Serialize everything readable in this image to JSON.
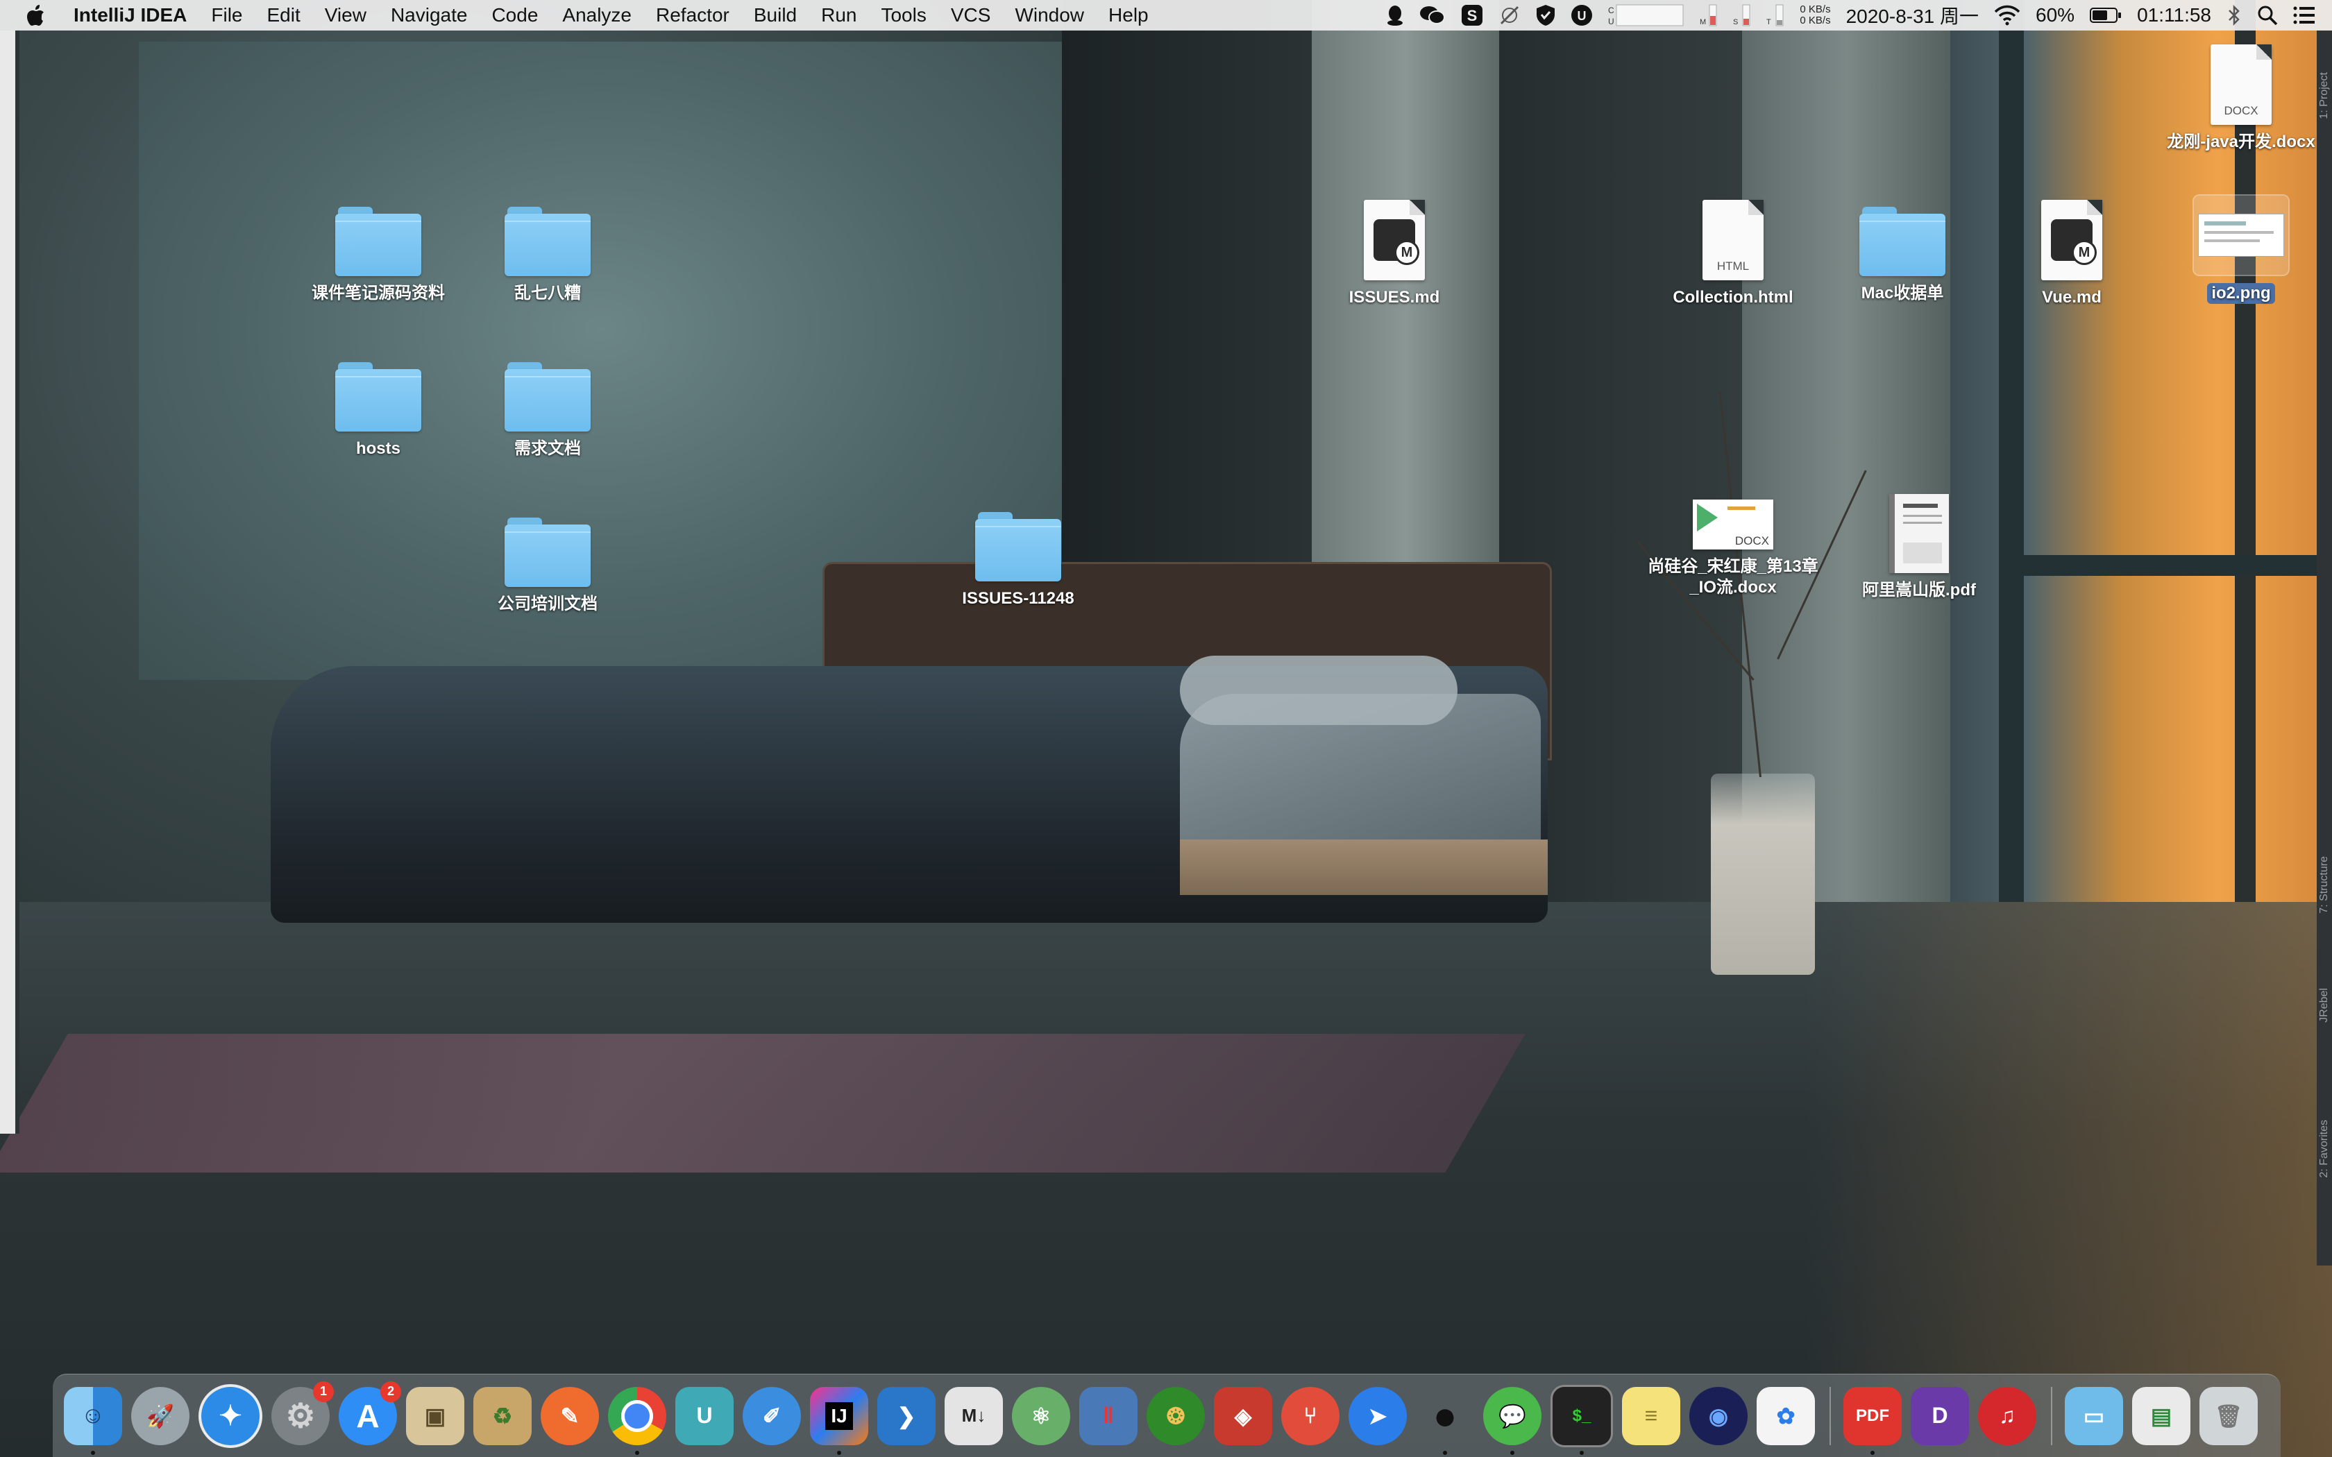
{
  "menubar": {
    "app_name": "IntelliJ IDEA",
    "menus": [
      "File",
      "Edit",
      "View",
      "Navigate",
      "Code",
      "Analyze",
      "Refactor",
      "Build",
      "Run",
      "Tools",
      "VCS",
      "Window",
      "Help"
    ],
    "net_up": "0 KB/s",
    "net_down": "0 KB/s",
    "date": "2020-8-31 周一",
    "battery": "60%",
    "time": "01:11:58"
  },
  "desktop": {
    "icons": [
      {
        "label": "课件笔记源码资料",
        "kind": "folder"
      },
      {
        "label": "乱七八糟",
        "kind": "folder"
      },
      {
        "label": "hosts",
        "kind": "folder"
      },
      {
        "label": "需求文档",
        "kind": "folder"
      },
      {
        "label": "公司培训文档",
        "kind": "folder"
      },
      {
        "label": "ISSUES-11248",
        "kind": "folder"
      },
      {
        "label": "ISSUES.md",
        "kind": "markdown"
      },
      {
        "label": "Collection.html",
        "kind": "html",
        "tag": "HTML"
      },
      {
        "label": "Mac收据单",
        "kind": "folder"
      },
      {
        "label": "Vue.md",
        "kind": "markdown"
      },
      {
        "label": "io2.png",
        "kind": "image"
      },
      {
        "label": "龙刚-java开发.docx",
        "kind": "docx",
        "tag": "DOCX"
      },
      {
        "label": "尚硅谷_宋红康_第13章_IO流.docx",
        "kind": "docx",
        "tag": "DOCX"
      },
      {
        "label": "阿里嵩山版.pdf",
        "kind": "pdf"
      }
    ]
  },
  "sidebar_right": {
    "labels": [
      "1: Project",
      "7: Structure",
      "JRebel",
      "2: Favorites"
    ]
  },
  "dock": {
    "apps": [
      {
        "name": "Finder",
        "badge": "",
        "running": true
      },
      {
        "name": "Launchpad",
        "badge": "",
        "running": false
      },
      {
        "name": "Safari",
        "badge": "",
        "running": false
      },
      {
        "name": "System Preferences",
        "badge": "1",
        "running": false
      },
      {
        "name": "App Store",
        "badge": "2",
        "running": false
      },
      {
        "name": "Preview",
        "badge": "",
        "running": false
      },
      {
        "name": "Archive Utility",
        "badge": "",
        "running": false
      },
      {
        "name": "Postman",
        "badge": "",
        "running": false
      },
      {
        "name": "Chrome",
        "badge": "",
        "running": true
      },
      {
        "name": "Typora",
        "badge": "",
        "running": false
      },
      {
        "name": "Sketch",
        "badge": "",
        "running": false
      },
      {
        "name": "IntelliJ IDEA",
        "badge": "",
        "running": true
      },
      {
        "name": "VS Code",
        "badge": "",
        "running": false
      },
      {
        "name": "Markdown",
        "badge": "",
        "running": false
      },
      {
        "name": "Atom",
        "badge": "",
        "running": false
      },
      {
        "name": "Parallels",
        "badge": "",
        "running": false
      },
      {
        "name": "Navicat",
        "badge": "",
        "running": false
      },
      {
        "name": "Redis",
        "badge": "",
        "running": false
      },
      {
        "name": "SourceTree",
        "badge": "",
        "running": false
      },
      {
        "name": "Feishu",
        "badge": "",
        "running": false
      },
      {
        "name": "QQ",
        "badge": "",
        "running": true
      },
      {
        "name": "WeChat",
        "badge": "",
        "running": true
      },
      {
        "name": "Terminal",
        "badge": "",
        "running": true
      },
      {
        "name": "Stickies",
        "badge": "",
        "running": false
      },
      {
        "name": "Instruments",
        "badge": "",
        "running": false
      },
      {
        "name": "Baidu Netdisk",
        "badge": "",
        "running": false
      },
      {
        "name": "PDF Expert",
        "badge": "",
        "running": true
      },
      {
        "name": "DataGrip",
        "badge": "",
        "running": false
      },
      {
        "name": "NetEase Music",
        "badge": "",
        "running": false
      },
      {
        "name": "Downloads",
        "badge": "",
        "running": false
      },
      {
        "name": "Documents",
        "badge": "",
        "running": false
      },
      {
        "name": "Trash",
        "badge": "",
        "running": false
      }
    ]
  },
  "colors": {
    "folder": "#7cc5f2",
    "selection": "#4a6fa5",
    "badge": "#e8372c"
  }
}
